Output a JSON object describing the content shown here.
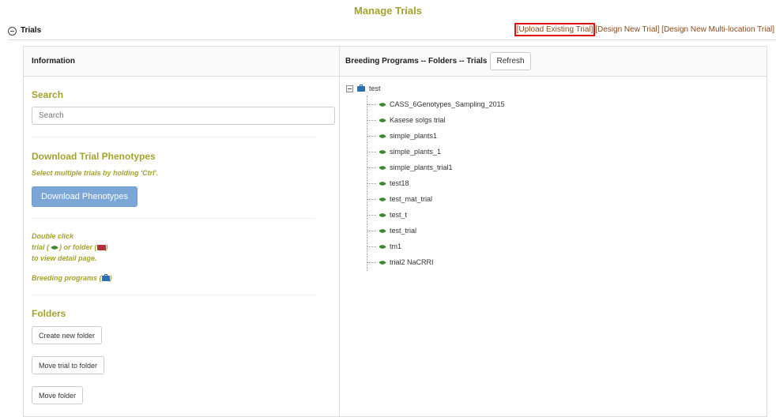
{
  "page": {
    "title": "Manage Trials"
  },
  "section": {
    "title": "Trials",
    "links": {
      "upload": "[Upload Existing Trial]",
      "design": "[Design New Trial]",
      "design_multi": "[Design New Multi-location Trial]"
    }
  },
  "left": {
    "header": "Information",
    "search": {
      "heading": "Search",
      "placeholder": "Search"
    },
    "download": {
      "heading": "Download Trial Phenotypes",
      "hint": "Select multiple trials by holding 'Ctrl'.",
      "button": "Download Phenotypes"
    },
    "help": {
      "line1": "Double click",
      "line2a": "trial (",
      "line2b": ") or folder (",
      "line2c": ")",
      "line3": "to view detail page.",
      "line4a": "Breeding programs (",
      "line4b": ")"
    },
    "folders": {
      "heading": "Folders",
      "create": "Create new folder",
      "move_trial": "Move trial to folder",
      "move_folder": "Move folder"
    }
  },
  "right": {
    "header": "Breeding Programs -- Folders -- Trials",
    "refresh": "Refresh",
    "tree": {
      "root": "test",
      "items": [
        "CASS_6Genotypes_Sampling_2015",
        "Kasese solgs trial",
        "simple_plants1",
        "simple_plants_1",
        "simple_plants_trial1",
        "test18",
        "test_mat_trial",
        "test_t",
        "test_trial",
        "tm1",
        "trial2 NaCRRI"
      ]
    }
  },
  "colors": {
    "accent": "#a3a32c",
    "link": "#8a4a1a",
    "highlight": "#e01010",
    "primary_button": "#7ba6d5"
  }
}
